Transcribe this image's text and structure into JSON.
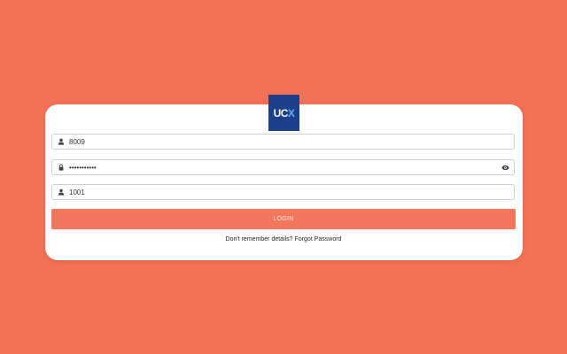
{
  "colors": {
    "background": "#F37257",
    "card": "#FFFFFF",
    "button": "#F2775C",
    "logo_bg": "#1D3F8C",
    "logo_accent": "#5BB3E6"
  },
  "logo": {
    "text_main": "UC",
    "text_accent": "X"
  },
  "form": {
    "username": {
      "icon": "user-icon",
      "value": "8009"
    },
    "password": {
      "icon": "lock-icon",
      "value": "•••••••••••",
      "toggle_icon": "eye-icon"
    },
    "extension": {
      "icon": "user-icon",
      "value": "1001"
    },
    "login_label": "LOGIN"
  },
  "help": {
    "question": "Don't remember details?",
    "link_label": "Forgot Password"
  }
}
